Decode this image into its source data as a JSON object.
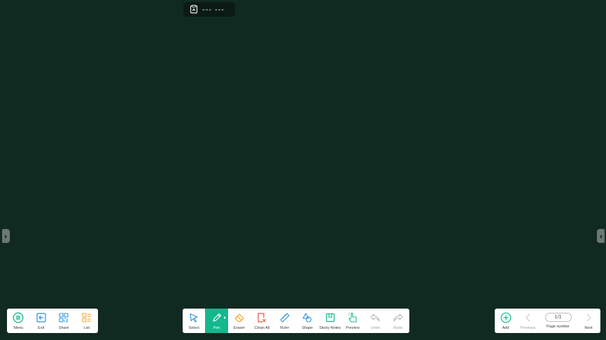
{
  "top_bar": {
    "title": "--- ---",
    "icon": "document-icon"
  },
  "left_toolbar": {
    "items": [
      {
        "label": "Menu",
        "icon": "menu-icon"
      },
      {
        "label": "Exit",
        "icon": "exit-icon"
      },
      {
        "label": "Share",
        "icon": "qr-icon"
      },
      {
        "label": "List",
        "icon": "list-icon"
      }
    ]
  },
  "main_toolbar": {
    "items": [
      {
        "label": "Select",
        "icon": "cursor-icon"
      },
      {
        "label": "Pen",
        "icon": "pen-icon",
        "active": true
      },
      {
        "label": "Eraser",
        "icon": "eraser-icon"
      },
      {
        "label": "Clean All",
        "icon": "clean-all-icon"
      },
      {
        "label": "Ruler",
        "icon": "ruler-icon"
      },
      {
        "label": "Shape",
        "icon": "shape-icon"
      },
      {
        "label": "Sticky-Notes",
        "icon": "sticky-note-icon"
      },
      {
        "label": "Preview",
        "icon": "hand-pointer-icon"
      },
      {
        "label": "Undo",
        "icon": "undo-icon",
        "disabled": true
      },
      {
        "label": "Redo",
        "icon": "redo-icon",
        "disabled": true
      }
    ]
  },
  "page_toolbar": {
    "add_label": "Add",
    "previous_label": "Previous",
    "page_number_value": "1/1",
    "page_number_label": "Page number",
    "next_label": "Next"
  },
  "colors": {
    "board": "#112a21",
    "accent": "#13b88c",
    "blue_icon": "#2a8fdc",
    "orange_icon": "#f2a21b",
    "red_icon": "#e8534a"
  }
}
